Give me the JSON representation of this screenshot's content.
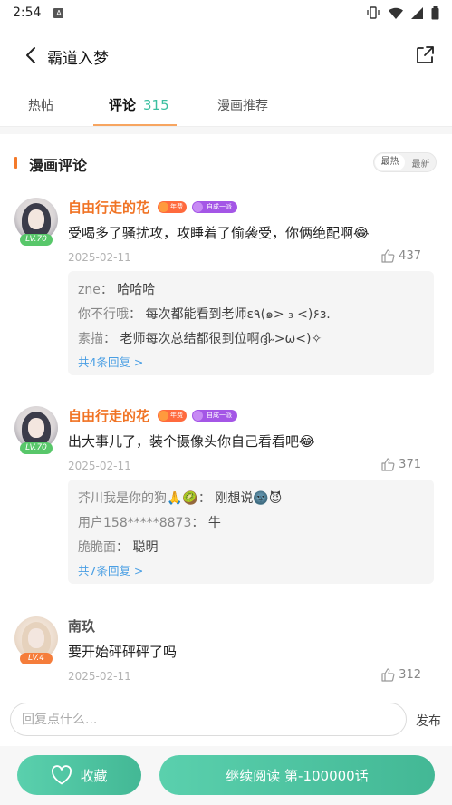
{
  "status_bar": {
    "time": "2:54",
    "notif_icon": "A"
  },
  "header": {
    "title": "霸道入梦"
  },
  "tabs": [
    {
      "label": "热帖"
    },
    {
      "label": "评论",
      "count": "315"
    },
    {
      "label": "漫画推荐"
    }
  ],
  "section": {
    "title": "漫画评论",
    "sort_hot": "最热",
    "sort_new": "最新"
  },
  "comments": [
    {
      "name": "自由行走的花",
      "level": "LV.70",
      "badge1": "年费",
      "badge2": "自成一派",
      "text": "受喝多了骚扰攻，攻睡着了偷袭受，你俩绝配啊😂",
      "date": "2025-02-11",
      "likes": "437",
      "replies": [
        {
          "name": "zne",
          "text": "哈哈哈"
        },
        {
          "name": "你不行哦",
          "text": "每次都能看到老师ε٩(๑> ₃ <)۶з."
        },
        {
          "name": "素描",
          "text": "老师每次总结都很到位啊ദ്ദി˶>ω<)✧"
        }
      ],
      "more": "共4条回复 >"
    },
    {
      "name": "自由行走的花",
      "level": "LV.70",
      "badge1": "年费",
      "badge2": "自成一派",
      "text": "出大事儿了，装个摄像头你自己看看吧😂",
      "date": "2025-02-11",
      "likes": "371",
      "replies": [
        {
          "name": "芥川我是你的狗🙏🥝",
          "text": "刚想说🌚😈"
        },
        {
          "name": "用户158*****8873",
          "text": "牛"
        },
        {
          "name": "脆脆面",
          "text": "聪明"
        }
      ],
      "more": "共7条回复 >"
    },
    {
      "name": "南玖",
      "level": "LV.4",
      "text": "要开始砰砰砰了吗",
      "date": "2025-02-11",
      "likes": "312"
    }
  ],
  "bottom": {
    "input_placeholder": "回复点什么...",
    "send_label": "发布",
    "fav_label": "收藏",
    "read_label": "继续阅读 第-100000话"
  },
  "colors": {
    "accent": "#43b895",
    "name_orange": "#f07324",
    "link_blue": "#4a9fe4"
  }
}
